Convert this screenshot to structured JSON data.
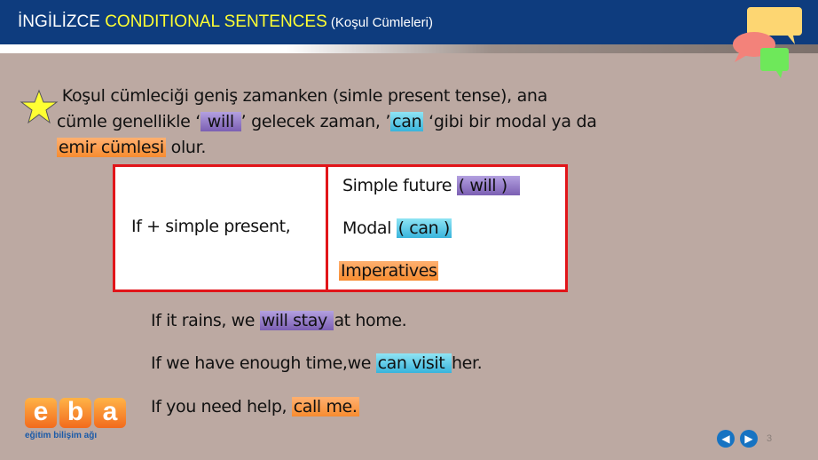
{
  "header": {
    "title_part1": "İNGİLİZCE ",
    "title_highlight": "CONDITIONAL  SENTENCES",
    "title_part2": " (Koşul Cümleleri)"
  },
  "intro": {
    "line1": "Koşul cümleciği geniş zamanken  (simle present tense), ana",
    "line2_a": "cümle genellikle ‘",
    "line2_will": " will ",
    "line2_b": "’ gelecek zaman, ’",
    "line2_can": "can",
    "line2_c": " ‘gibi bir modal ya da",
    "line3_emir": "emir cümlesi",
    "line3_b": " olur."
  },
  "table": {
    "left": "If + simple present,",
    "right": [
      {
        "text": "Simple future ",
        "highlight": "( will )",
        "color": "purple"
      },
      {
        "text": "Modal ",
        "highlight": "( can )",
        "color": "blue"
      },
      {
        "text": "",
        "highlight": "Imperatives ",
        "color": "orange"
      }
    ]
  },
  "examples": [
    {
      "before": "If it rains, we ",
      "highlight": "will stay ",
      "after": "at home.",
      "color": "purple"
    },
    {
      "before": "If we have enough time,we ",
      "highlight": "can visit ",
      "after": "her.",
      "color": "blue"
    },
    {
      "before": "If you need help, ",
      "highlight": "call me.",
      "after": "",
      "color": "orange"
    }
  ],
  "logo": {
    "name": "eba",
    "subtitle": "eğitim bilişim ağı"
  },
  "navigation": {
    "prev_icon": "arrow-left-icon",
    "next_icon": "arrow-right-icon",
    "page_number": "3"
  },
  "colors": {
    "header_bg": "#0e3c7e",
    "title_highlight": "#ffff33",
    "background": "#bca9a2",
    "box_border": "#e1151a"
  }
}
